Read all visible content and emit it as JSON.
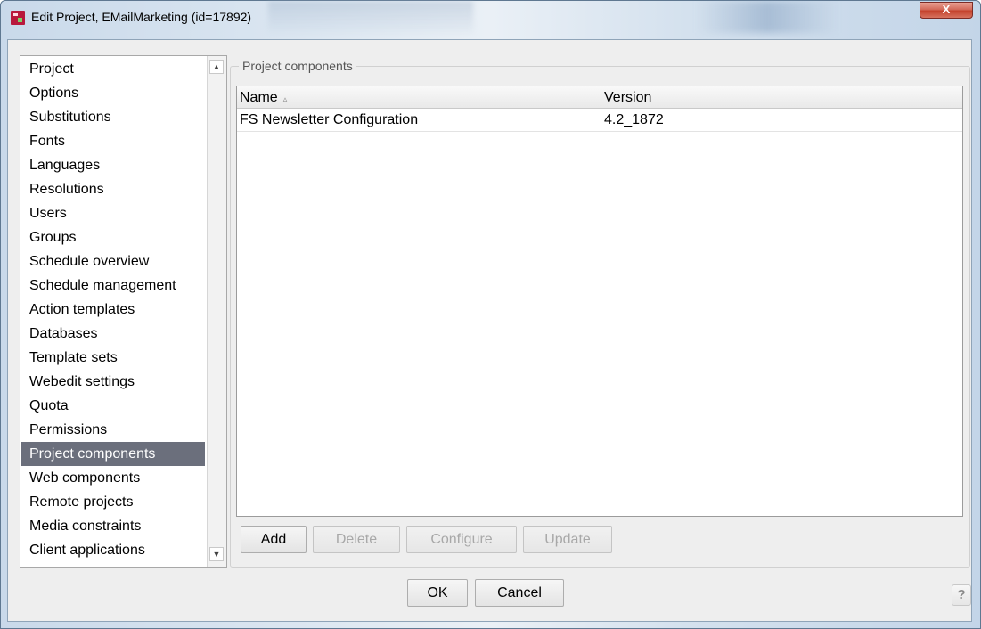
{
  "window": {
    "title": "Edit Project, EMailMarketing (id=17892)",
    "close_glyph": "X",
    "app_icon": "firstspirit-app-icon"
  },
  "sidebar": {
    "items": [
      {
        "label": "Project",
        "selected": false
      },
      {
        "label": "Options",
        "selected": false
      },
      {
        "label": "Substitutions",
        "selected": false
      },
      {
        "label": "Fonts",
        "selected": false
      },
      {
        "label": "Languages",
        "selected": false
      },
      {
        "label": "Resolutions",
        "selected": false
      },
      {
        "label": "Users",
        "selected": false
      },
      {
        "label": "Groups",
        "selected": false
      },
      {
        "label": "Schedule overview",
        "selected": false
      },
      {
        "label": "Schedule management",
        "selected": false
      },
      {
        "label": "Action templates",
        "selected": false
      },
      {
        "label": "Databases",
        "selected": false
      },
      {
        "label": "Template sets",
        "selected": false
      },
      {
        "label": "Webedit settings",
        "selected": false
      },
      {
        "label": "Quota",
        "selected": false
      },
      {
        "label": "Permissions",
        "selected": false
      },
      {
        "label": "Project components",
        "selected": true
      },
      {
        "label": "Web components",
        "selected": false
      },
      {
        "label": "Remote projects",
        "selected": false
      },
      {
        "label": "Media constraints",
        "selected": false
      },
      {
        "label": "Client applications",
        "selected": false
      }
    ],
    "scroll_up_glyph": "▲",
    "scroll_down_glyph": "▼"
  },
  "panel": {
    "title": "Project components",
    "table": {
      "columns": [
        {
          "label": "Name",
          "sort_glyph": "▵"
        },
        {
          "label": "Version"
        }
      ],
      "rows": [
        {
          "name": "FS Newsletter Configuration",
          "version": "4.2_1872"
        }
      ]
    },
    "buttons": {
      "add": "Add",
      "delete": "Delete",
      "configure": "Configure",
      "update": "Update"
    }
  },
  "footer": {
    "ok": "OK",
    "cancel": "Cancel",
    "help": "?"
  },
  "colors": {
    "selection": "#6b6f7c",
    "close_button": "#c4412c"
  }
}
